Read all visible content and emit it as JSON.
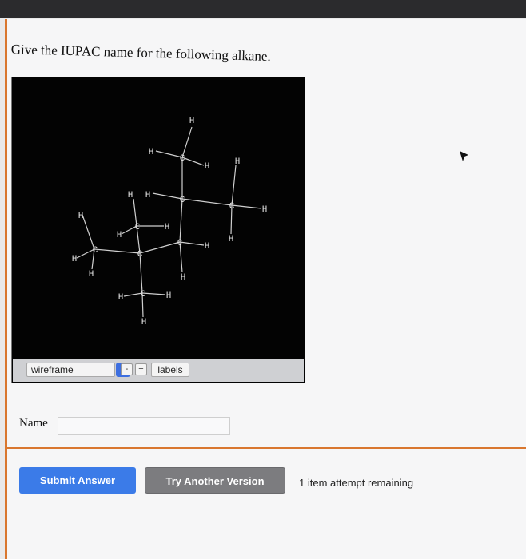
{
  "question": {
    "text": "Give the IUPAC name for the following alkane."
  },
  "viewer": {
    "mode": "wireframe",
    "zoom_out": "-",
    "zoom_in": "+",
    "labels_button": "labels",
    "atoms": {
      "h1": "H",
      "h2": "H",
      "h3": "H",
      "h4": "H",
      "h5": "H",
      "h6": "H",
      "h7": "H",
      "h8": "H",
      "h9": "H",
      "h10": "H",
      "h11": "H",
      "h12": "H",
      "h13": "H",
      "h14": "H",
      "h15": "H",
      "h16": "H",
      "c1": "C",
      "c2": "C",
      "c3": "C",
      "c4": "C",
      "c5": "C",
      "c6": "C",
      "c7": "C"
    }
  },
  "form": {
    "name_label": "Name",
    "name_value": "",
    "name_placeholder": ""
  },
  "actions": {
    "submit": "Submit Answer",
    "try_another": "Try Another Version",
    "attempts": "1 item attempt remaining"
  },
  "colors": {
    "accent": "#d9772f",
    "primary_button": "#3b7be8",
    "secondary_button": "#7c7c7f"
  }
}
